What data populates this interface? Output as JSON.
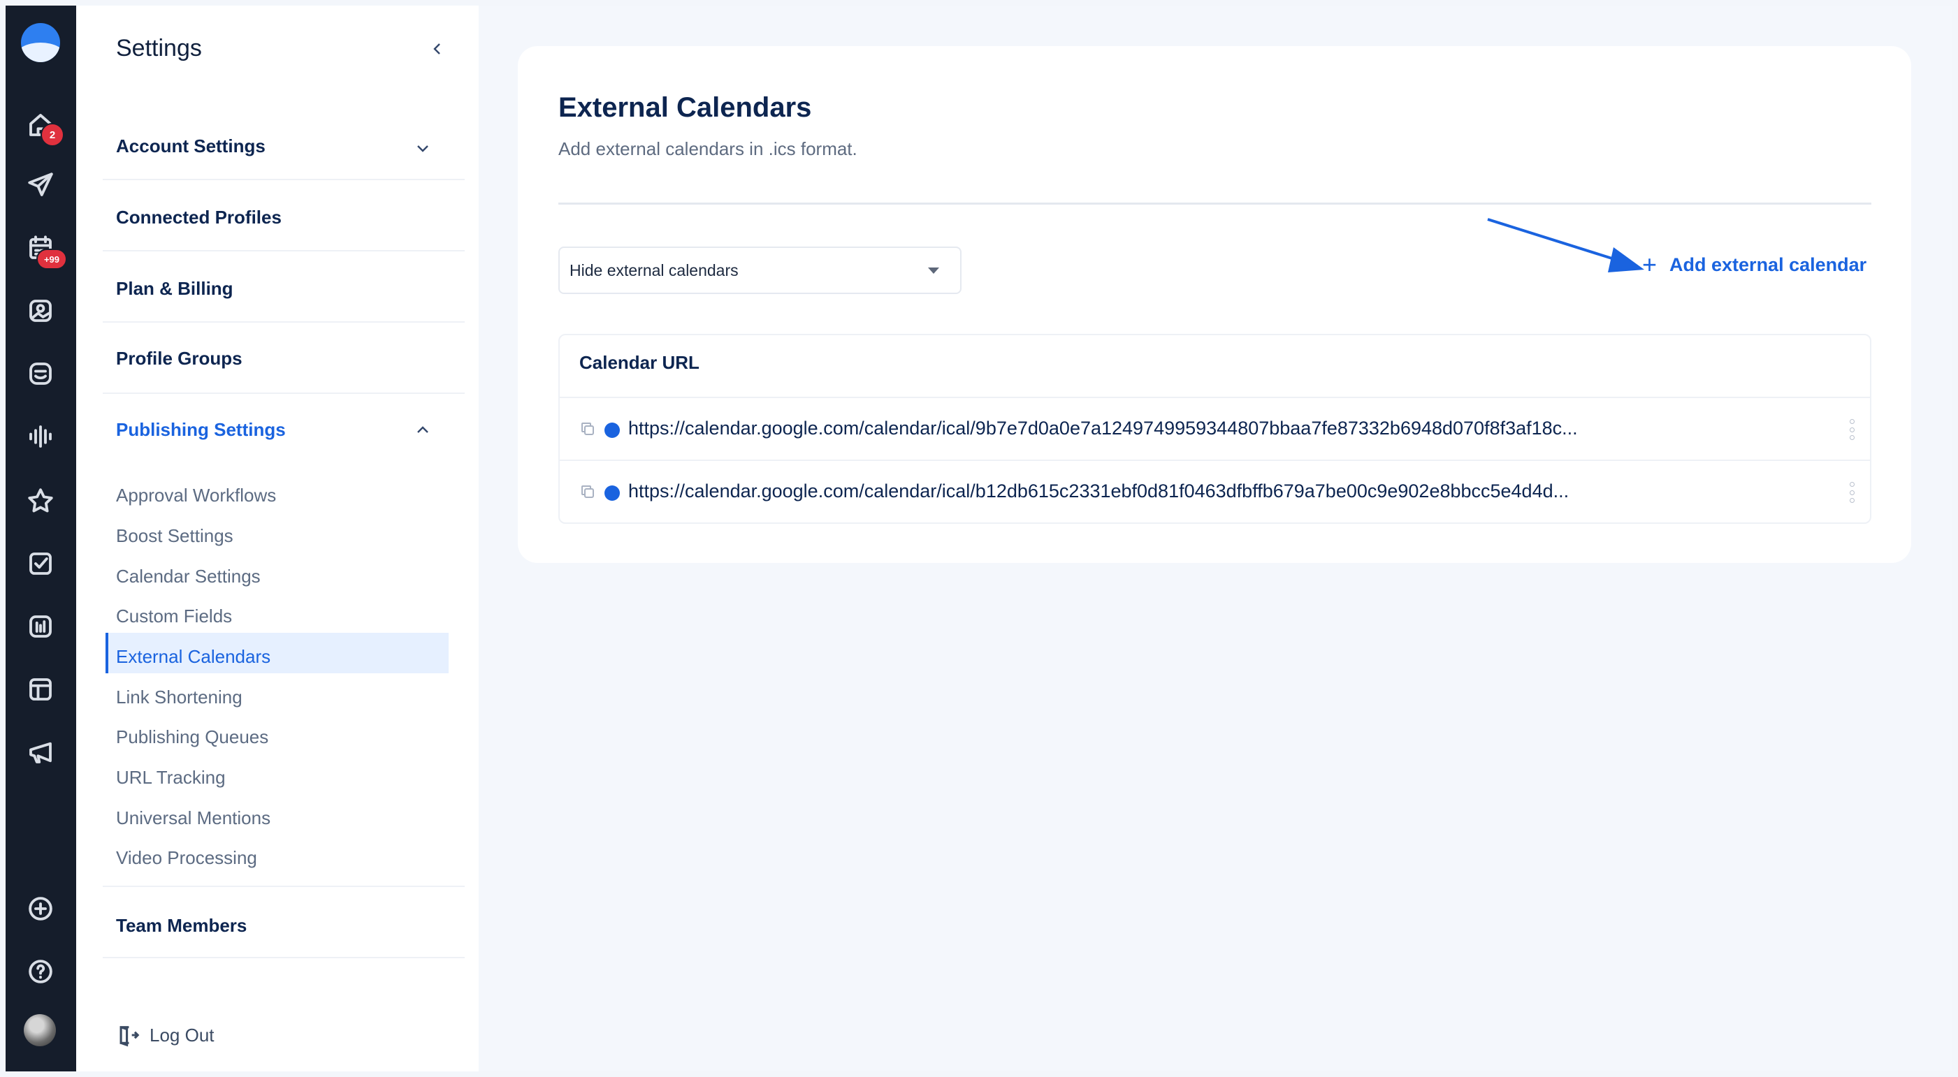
{
  "rail": {
    "items": [
      {
        "icon": "home-icon",
        "badge": "2"
      },
      {
        "icon": "send-icon"
      },
      {
        "icon": "calendar-icon",
        "badge": "+99"
      },
      {
        "icon": "media-icon"
      },
      {
        "icon": "inbox-icon"
      },
      {
        "icon": "audio-wave-icon"
      },
      {
        "icon": "star-icon"
      },
      {
        "icon": "task-check-icon"
      },
      {
        "icon": "analytics-icon"
      },
      {
        "icon": "layout-icon"
      },
      {
        "icon": "megaphone-icon"
      }
    ],
    "bottom": [
      {
        "icon": "add-circle-icon"
      },
      {
        "icon": "help-icon"
      },
      {
        "icon": "avatar"
      }
    ]
  },
  "sidebar": {
    "title": "Settings",
    "sections": [
      {
        "label": "Account Settings",
        "expandable": true,
        "expanded": false
      },
      {
        "label": "Connected Profiles"
      },
      {
        "label": "Plan & Billing"
      },
      {
        "label": "Profile Groups"
      },
      {
        "label": "Publishing Settings",
        "expandable": true,
        "expanded": true,
        "active": true
      },
      {
        "label": "Team Members"
      }
    ],
    "publishing_items": [
      "Approval Workflows",
      "Boost Settings",
      "Calendar Settings",
      "Custom Fields",
      "External Calendars",
      "Link Shortening",
      "Publishing Queues",
      "URL Tracking",
      "Universal Mentions",
      "Video Processing"
    ],
    "active_item": "External Calendars",
    "logout_label": "Log Out"
  },
  "main": {
    "title": "External Calendars",
    "subtitle": "Add external calendars in .ics format.",
    "filter_select": {
      "value": "Hide external calendars"
    },
    "add_button_label": "Add external calendar",
    "table": {
      "header": "Calendar URL",
      "rows": [
        {
          "url": "https://calendar.google.com/calendar/ical/9b7e7d0a0e7a1249749959344807bbaa7fe87332b6948d070f8f3af18c...",
          "color": "#1a63df"
        },
        {
          "url": "https://calendar.google.com/calendar/ical/b12db615c2331ebf0d81f0463dfbffb679a7be00c9e902e8bbcc5e4d4d...",
          "color": "#1a63df"
        }
      ]
    }
  },
  "colors": {
    "rail_bg": "#151d2b",
    "accent": "#1a63df",
    "badge": "#e0313e",
    "page_bg": "#f4f7fc"
  }
}
